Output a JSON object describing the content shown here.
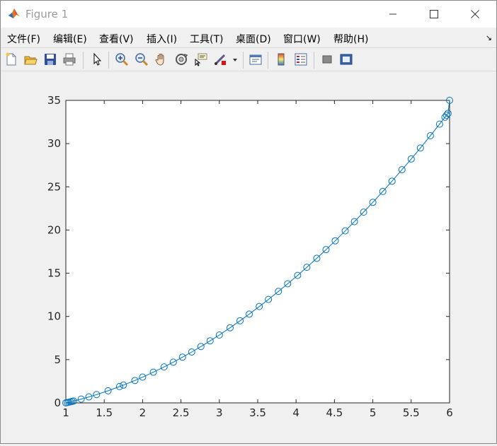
{
  "window": {
    "title": "Figure 1",
    "controls": {
      "minimize": "minimize-icon",
      "maximize": "maximize-icon",
      "close": "close-icon"
    }
  },
  "menu": {
    "items": [
      {
        "label": "文件(F)"
      },
      {
        "label": "编辑(E)"
      },
      {
        "label": "查看(V)"
      },
      {
        "label": "插入(I)"
      },
      {
        "label": "工具(T)"
      },
      {
        "label": "桌面(D)"
      },
      {
        "label": "窗口(W)"
      },
      {
        "label": "帮助(H)"
      }
    ],
    "dock_arrow": "↘"
  },
  "toolbar": {
    "icons": [
      "new-figure-icon",
      "open-file-icon",
      "save-icon",
      "print-icon",
      "select-arrow-icon",
      "zoom-in-icon",
      "zoom-out-icon",
      "pan-hand-icon",
      "rotate-3d-icon",
      "data-cursor-icon",
      "brush-icon",
      "brush-dropdown-icon",
      "link-plot-icon",
      "colorbar-icon",
      "legend-icon",
      "hide-plot-tools-icon",
      "show-plot-tools-icon"
    ]
  },
  "colors": {
    "line": "#0072bd",
    "axes_bg": "#ffffff",
    "figure_bg": "#f0f0f0"
  },
  "chart_data": {
    "type": "line",
    "title": "",
    "xlabel": "",
    "ylabel": "",
    "xlim": [
      1,
      6
    ],
    "ylim": [
      0,
      35
    ],
    "xticks": [
      "1",
      "1.5",
      "2",
      "2.5",
      "3",
      "3.5",
      "4",
      "4.5",
      "5",
      "5.5",
      "6"
    ],
    "yticks": [
      "0",
      "5",
      "10",
      "15",
      "20",
      "25",
      "30",
      "35"
    ],
    "grid": false,
    "marker": "circle",
    "series": [
      {
        "x": [
          1.0,
          1.02,
          1.04,
          1.06,
          1.08,
          1.1,
          1.2,
          1.3,
          1.4,
          1.55,
          1.7,
          1.75,
          1.9,
          2.0,
          2.14,
          2.28,
          2.4,
          2.52,
          2.64,
          2.76,
          2.88,
          3.0,
          3.14,
          3.27,
          3.39,
          3.52,
          3.64,
          3.77,
          3.89,
          4.02,
          4.14,
          4.27,
          4.39,
          4.51,
          4.64,
          4.76,
          4.88,
          5.0,
          5.13,
          5.25,
          5.38,
          5.5,
          5.62,
          5.75,
          5.87,
          5.94,
          5.96,
          5.98,
          6.0
        ],
        "y": [
          0.0,
          0.04,
          0.08,
          0.12,
          0.17,
          0.21,
          0.44,
          0.69,
          0.96,
          1.4,
          1.89,
          2.06,
          2.59,
          2.98,
          3.55,
          4.16,
          4.71,
          5.29,
          5.89,
          6.52,
          7.18,
          7.85,
          8.69,
          9.5,
          10.27,
          11.15,
          11.97,
          12.9,
          13.78,
          14.75,
          15.69,
          16.73,
          17.73,
          18.75,
          19.9,
          20.97,
          22.07,
          23.2,
          24.46,
          25.65,
          26.98,
          28.22,
          29.49,
          30.91,
          32.25,
          33.05,
          33.28,
          33.5,
          35.0
        ]
      }
    ]
  }
}
